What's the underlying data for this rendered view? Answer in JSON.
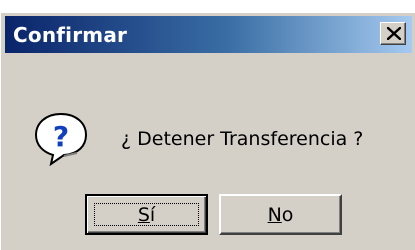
{
  "dialog": {
    "title": "Confirmar",
    "message": "¿ Detener Transferencia ?",
    "icon": "question-icon",
    "buttons": {
      "yes": {
        "accel": "S",
        "rest": "í"
      },
      "no": {
        "accel": "N",
        "rest": "o"
      }
    }
  },
  "colors": {
    "titlebar_start": "#0a246a",
    "titlebar_end": "#a6caf0",
    "face": "#d4d0c8",
    "icon_blue": "#1040c0"
  }
}
